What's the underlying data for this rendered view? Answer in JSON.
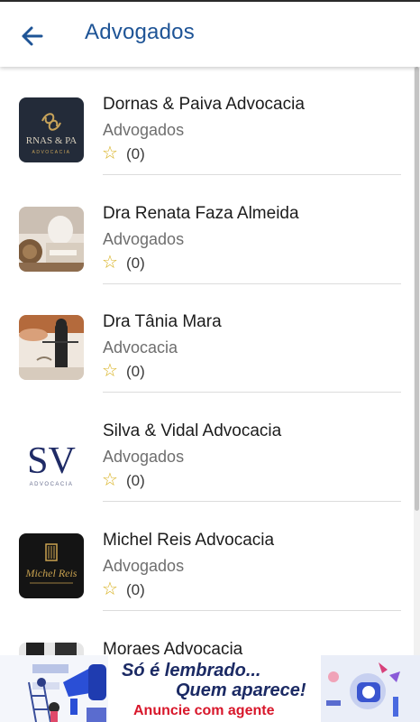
{
  "appbar": {
    "title": "Advogados",
    "back_icon": "arrow-left-icon"
  },
  "colors": {
    "title": "#1e5496",
    "star": "#d8b11f"
  },
  "items": [
    {
      "name": "Dornas & Paiva Advocacia",
      "category": "Advogados",
      "rating_count": "(0)",
      "logo_text": "RNAS & PA",
      "logo_sub": "ADVOCACIA"
    },
    {
      "name": "Dra Renata Faza Almeida",
      "category": "Advogados",
      "rating_count": "(0)"
    },
    {
      "name": "Dra Tânia Mara",
      "category": "Advocacia",
      "rating_count": "(0)"
    },
    {
      "name": "Silva & Vidal Advocacia",
      "category": "Advogados",
      "rating_count": "(0)",
      "logo_text": "SV",
      "logo_sub": "ADVOCACIA"
    },
    {
      "name": "Michel Reis Advocacia",
      "category": "Advogados",
      "rating_count": "(0)",
      "logo_text": "Michel Reis"
    },
    {
      "name": "Moraes Advocacia"
    }
  ],
  "banner": {
    "line1": "Só é lembrado...",
    "line2": "Quem aparece!",
    "line3": "Anuncie com agente"
  }
}
